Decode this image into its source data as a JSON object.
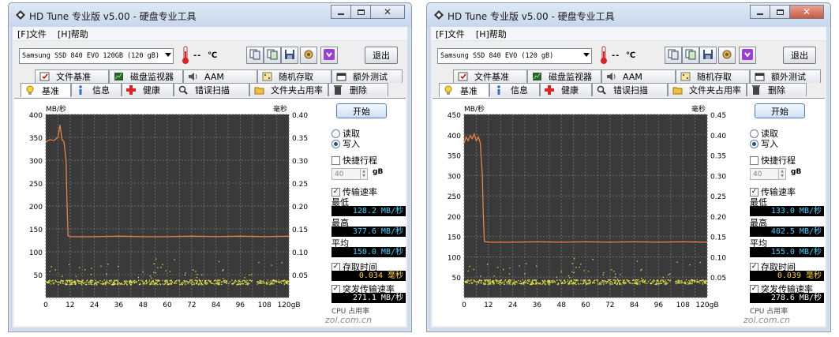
{
  "windows": [
    {
      "title": "HD Tune 专业版 v5.00 - 硬盘专业工具",
      "menu": [
        "[F]文件",
        "[H]帮助"
      ],
      "drive": "Samsung SSD 840 EVO 120GB (120 gB)",
      "temperature": "--",
      "temp_unit": "℃",
      "exit_label": "退出",
      "tabs_row1": [
        "文件基准",
        "磁盘监视器",
        "AAM",
        "随机存取",
        "额外测试"
      ],
      "tabs_row2": [
        "基准",
        "信息",
        "健康",
        "错误扫描",
        "文件夹占用率",
        "删除"
      ],
      "start_label": "开始",
      "read_label": "读取",
      "write_label": "写入",
      "shortstroke_label": "快捷行程",
      "shortstroke_value": "40",
      "gb_unit": "gB",
      "transfer_label": "传输速率",
      "min_label": "最低",
      "min_value": "128.2 MB/秒",
      "max_label": "最高",
      "max_value": "377.6 MB/秒",
      "avg_label": "平均",
      "avg_value": "150.0 MB/秒",
      "access_label": "存取时间",
      "access_value": "0.034 毫秒",
      "burst_label": "突发传输速率",
      "burst_value": "271.1 MB/秒",
      "cpu_label": "CPU 占用率",
      "watermark": "zol.com.cn",
      "chart_data": {
        "type": "line",
        "ylabel": "MB/秒",
        "y2label": "毫秒",
        "ylim": [
          0,
          400
        ],
        "y2lim": [
          0,
          0.4
        ],
        "xlim": [
          0,
          120
        ],
        "x_unit": "gB",
        "x_ticks": [
          "0",
          "12",
          "24",
          "36",
          "48",
          "60",
          "72",
          "84",
          "96",
          "108",
          "120gB"
        ],
        "y_ticks": [
          "400",
          "350",
          "300",
          "250",
          "200",
          "150",
          "100",
          "50"
        ],
        "y2_ticks": [
          "0.40",
          "0.35",
          "0.30",
          "0.25",
          "0.20",
          "0.15",
          "0.10",
          "0.05"
        ],
        "grid": true,
        "series": [
          {
            "name": "传输速率",
            "color": "#e8844a",
            "x": [
              0,
              2,
              4,
              6,
              7,
              8,
              9,
              10,
              10.5,
              11,
              12,
              24,
              36,
              48,
              60,
              72,
              84,
              96,
              108,
              120
            ],
            "values": [
              340,
              345,
              343,
              350,
              377,
              345,
              340,
              300,
              200,
              135,
              133,
              133,
              134,
              133,
              133,
              134,
              133,
              134,
              133,
              134
            ]
          },
          {
            "name": "存取时间",
            "color": "#e8e84a",
            "scatter_level_ms": 0.034
          }
        ]
      }
    },
    {
      "title": "HD Tune 专业版 v5.00 - 硬盘专业工具",
      "menu": [
        "[F]文件",
        "[H]帮助"
      ],
      "drive": "Samsung SSD 840 EVO (120 gB)",
      "temperature": "--",
      "temp_unit": "℃",
      "exit_label": "退出",
      "tabs_row1": [
        "文件基准",
        "磁盘监视器",
        "AAM",
        "随机存取",
        "额外测试"
      ],
      "tabs_row2": [
        "基准",
        "信息",
        "健康",
        "错误扫描",
        "文件夹占用率",
        "删除"
      ],
      "start_label": "开始",
      "read_label": "读取",
      "write_label": "写入",
      "shortstroke_label": "快捷行程",
      "shortstroke_value": "40",
      "gb_unit": "gB",
      "transfer_label": "传输速率",
      "min_label": "最低",
      "min_value": "133.0 MB/秒",
      "max_label": "最高",
      "max_value": "402.5 MB/秒",
      "avg_label": "平均",
      "avg_value": "155.0 MB/秒",
      "access_label": "存取时间",
      "access_value": "0.039 毫秒",
      "burst_label": "突发传输速率",
      "burst_value": "278.6 MB/秒",
      "cpu_label": "CPU 占用率",
      "watermark": "zol.com.cn",
      "chart_data": {
        "type": "line",
        "ylabel": "MB/秒",
        "y2label": "毫秒",
        "ylim": [
          0,
          450
        ],
        "y2lim": [
          0,
          0.45
        ],
        "xlim": [
          0,
          120
        ],
        "x_unit": "gB",
        "x_ticks": [
          "0",
          "12",
          "24",
          "36",
          "48",
          "60",
          "72",
          "84",
          "96",
          "108",
          "120gB"
        ],
        "y_ticks": [
          "450",
          "400",
          "350",
          "300",
          "250",
          "200",
          "150",
          "100",
          "50"
        ],
        "y2_ticks": [
          "0.45",
          "0.40",
          "0.35",
          "0.30",
          "0.25",
          "0.20",
          "0.15",
          "0.10",
          "0.05"
        ],
        "grid": true,
        "series": [
          {
            "name": "传输速率",
            "color": "#e8844a",
            "x": [
              0,
              1,
              2,
              3,
              4,
              5,
              6,
              7,
              8,
              9,
              9.5,
              10,
              12,
              24,
              36,
              48,
              60,
              72,
              84,
              96,
              108,
              120
            ],
            "values": [
              380,
              395,
              385,
              398,
              390,
              402,
              385,
              395,
              380,
              300,
              200,
              138,
              136,
              136,
              137,
              136,
              137,
              136,
              137,
              136,
              137,
              136
            ]
          },
          {
            "name": "存取时间",
            "color": "#e8e84a",
            "scatter_level_ms": 0.039
          }
        ]
      }
    }
  ]
}
